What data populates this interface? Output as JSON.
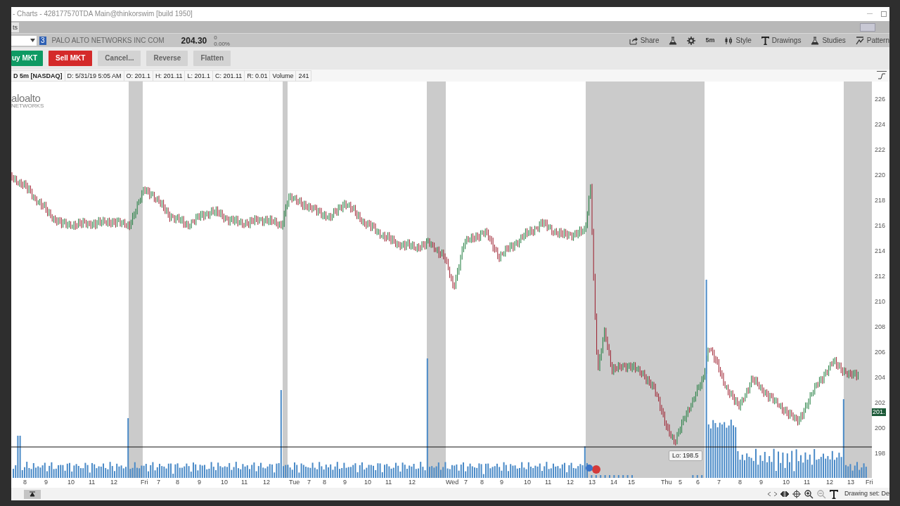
{
  "window": {
    "title": "- Charts - 428177570TDA Main@thinkorswim [build 1950]"
  },
  "tabs": [
    {
      "label": "ts",
      "selected": true
    }
  ],
  "layout_toggle": {
    "on": true
  },
  "quote_bar": {
    "badge": "3",
    "company": "PALO ALTO NETWORKS INC COM",
    "last": "204.30",
    "change": "0",
    "change_percent": "0.00%"
  },
  "toolbar": [
    {
      "kind": "share",
      "label": "Share"
    },
    {
      "kind": "flask"
    },
    {
      "kind": "gear"
    },
    {
      "kind": "text",
      "label": "5m"
    },
    {
      "kind": "style",
      "label": "Style"
    },
    {
      "kind": "drawings",
      "label": "Drawings"
    },
    {
      "kind": "studies",
      "label": "Studies"
    },
    {
      "kind": "patterns",
      "label": "Pattern"
    }
  ],
  "order_buttons": [
    {
      "label": "uy MKT",
      "kind": "buy",
      "disabled": false
    },
    {
      "label": "Sell MKT",
      "kind": "sell",
      "disabled": false
    },
    {
      "label": "Cancel...",
      "kind": "plain",
      "disabled": true
    },
    {
      "label": "Reverse",
      "kind": "plain",
      "disabled": true
    },
    {
      "label": "Flatten",
      "kind": "plain",
      "disabled": true
    }
  ],
  "info_strip": [
    "D 5m [NASDAQ]",
    "D: 5/31/19 5:05 AM",
    "O: 201.1",
    "H: 201.11",
    "L: 201.1",
    "C: 201.11",
    "R: 0.01",
    "Volume",
    "241"
  ],
  "logo": {
    "name": "aloalto",
    "sub": "NETWORKS"
  },
  "price_axis": [
    "226",
    "224",
    "222",
    "220",
    "218",
    "216",
    "214",
    "212",
    "210",
    "208",
    "206",
    "204",
    "202",
    "200",
    "198"
  ],
  "current_price": "201.",
  "low_label": "Lo: 198.5",
  "time_axis": [
    "8",
    "9",
    "10",
    "11",
    "12",
    "Fri",
    "7",
    "8",
    "9",
    "10",
    "11",
    "12",
    "Tue",
    "7",
    "8",
    "9",
    "10",
    "11",
    "12",
    "Wed",
    "7",
    "8",
    "9",
    "10",
    "11",
    "12",
    "13",
    "14",
    "15",
    "Thu",
    "5",
    "6",
    "7",
    "8",
    "9",
    "10",
    "11",
    "12",
    "13",
    "Fri"
  ],
  "status": {
    "drawing_set": "Drawing set: De"
  }
}
